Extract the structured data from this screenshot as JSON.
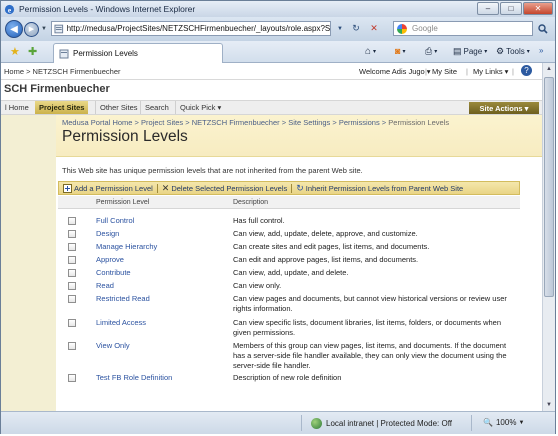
{
  "window": {
    "title": "Permission Levels - Windows Internet Explorer",
    "minimize": "–",
    "maximize": "□",
    "close": "✕"
  },
  "browser": {
    "url": "http://medusa/ProjectSites/NETZSCHFirmenbuecher/_layouts/role.aspx?Sour",
    "search_placeholder": "Google",
    "tab_title": "Permission Levels",
    "commands": {
      "page": "Page",
      "tools": "Tools"
    }
  },
  "sharepoint": {
    "top_crumb": "Home > NETZSCH Firmenbuecher",
    "welcome": "Welcome Adis Jugo ▾",
    "my_site": "My Site",
    "my_links": "My Links ▾",
    "site_name": "SCH Firmenbuecher",
    "nav": [
      "l Home",
      "Project Sites",
      "Other Sites",
      "Search",
      "Quick Pick ▾"
    ],
    "site_actions": "Site Actions ▾"
  },
  "page": {
    "breadcrumb": [
      "Medusa Portal Home",
      "Project Sites",
      "NETZSCH Firmenbuecher",
      "Site Settings",
      "Permissions"
    ],
    "breadcrumb_current": "Permission Levels",
    "title": "Permission Levels",
    "description": "This Web site has unique permission levels that are not inherited from the parent Web site.",
    "toolbar": {
      "add": "Add a Permission Level",
      "delete": "Delete Selected Permission Levels",
      "inherit": "Inherit Permission Levels from Parent Web Site"
    },
    "columns": {
      "level": "Permission Level",
      "description": "Description"
    },
    "rows": [
      {
        "name": "Full Control",
        "description": "Has full control."
      },
      {
        "name": "Design",
        "description": "Can view, add, update, delete, approve, and customize."
      },
      {
        "name": "Manage Hierarchy",
        "description": "Can create sites and edit pages, list items, and documents."
      },
      {
        "name": "Approve",
        "description": "Can edit and approve pages, list items, and documents."
      },
      {
        "name": "Contribute",
        "description": "Can view, add, update, and delete."
      },
      {
        "name": "Read",
        "description": "Can view only."
      },
      {
        "name": "Restricted Read",
        "description": "Can view pages and documents, but cannot view historical versions or review user rights information."
      },
      {
        "name": "Limited Access",
        "description": "Can view specific lists, document libraries, list items, folders, or documents when given permissions."
      },
      {
        "name": "View Only",
        "description": "Members of this group can view pages, list items, and documents. If the document has a server-side file handler available, they can only view the document using the server-side file handler."
      },
      {
        "name": "Test FB Role Definition",
        "description": "Description of new role definition"
      }
    ]
  },
  "status": {
    "zone": "Local intranet | Protected Mode: Off",
    "zoom": "100%"
  },
  "colors": {
    "accent_gold": "#cbb24c",
    "link_blue": "#2b52a0",
    "header_yellow": "#f7ecc1"
  }
}
